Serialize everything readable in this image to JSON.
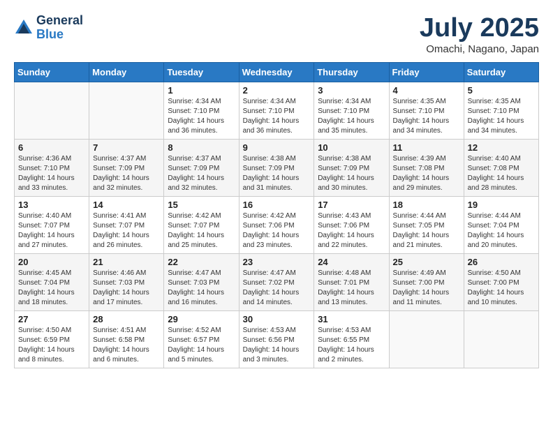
{
  "header": {
    "logo_general": "General",
    "logo_blue": "Blue",
    "month_title": "July 2025",
    "location": "Omachi, Nagano, Japan"
  },
  "days_of_week": [
    "Sunday",
    "Monday",
    "Tuesday",
    "Wednesday",
    "Thursday",
    "Friday",
    "Saturday"
  ],
  "weeks": [
    [
      {
        "day": "",
        "info": ""
      },
      {
        "day": "",
        "info": ""
      },
      {
        "day": "1",
        "info": "Sunrise: 4:34 AM\nSunset: 7:10 PM\nDaylight: 14 hours\nand 36 minutes."
      },
      {
        "day": "2",
        "info": "Sunrise: 4:34 AM\nSunset: 7:10 PM\nDaylight: 14 hours\nand 36 minutes."
      },
      {
        "day": "3",
        "info": "Sunrise: 4:34 AM\nSunset: 7:10 PM\nDaylight: 14 hours\nand 35 minutes."
      },
      {
        "day": "4",
        "info": "Sunrise: 4:35 AM\nSunset: 7:10 PM\nDaylight: 14 hours\nand 34 minutes."
      },
      {
        "day": "5",
        "info": "Sunrise: 4:35 AM\nSunset: 7:10 PM\nDaylight: 14 hours\nand 34 minutes."
      }
    ],
    [
      {
        "day": "6",
        "info": "Sunrise: 4:36 AM\nSunset: 7:10 PM\nDaylight: 14 hours\nand 33 minutes."
      },
      {
        "day": "7",
        "info": "Sunrise: 4:37 AM\nSunset: 7:09 PM\nDaylight: 14 hours\nand 32 minutes."
      },
      {
        "day": "8",
        "info": "Sunrise: 4:37 AM\nSunset: 7:09 PM\nDaylight: 14 hours\nand 32 minutes."
      },
      {
        "day": "9",
        "info": "Sunrise: 4:38 AM\nSunset: 7:09 PM\nDaylight: 14 hours\nand 31 minutes."
      },
      {
        "day": "10",
        "info": "Sunrise: 4:38 AM\nSunset: 7:09 PM\nDaylight: 14 hours\nand 30 minutes."
      },
      {
        "day": "11",
        "info": "Sunrise: 4:39 AM\nSunset: 7:08 PM\nDaylight: 14 hours\nand 29 minutes."
      },
      {
        "day": "12",
        "info": "Sunrise: 4:40 AM\nSunset: 7:08 PM\nDaylight: 14 hours\nand 28 minutes."
      }
    ],
    [
      {
        "day": "13",
        "info": "Sunrise: 4:40 AM\nSunset: 7:07 PM\nDaylight: 14 hours\nand 27 minutes."
      },
      {
        "day": "14",
        "info": "Sunrise: 4:41 AM\nSunset: 7:07 PM\nDaylight: 14 hours\nand 26 minutes."
      },
      {
        "day": "15",
        "info": "Sunrise: 4:42 AM\nSunset: 7:07 PM\nDaylight: 14 hours\nand 25 minutes."
      },
      {
        "day": "16",
        "info": "Sunrise: 4:42 AM\nSunset: 7:06 PM\nDaylight: 14 hours\nand 23 minutes."
      },
      {
        "day": "17",
        "info": "Sunrise: 4:43 AM\nSunset: 7:06 PM\nDaylight: 14 hours\nand 22 minutes."
      },
      {
        "day": "18",
        "info": "Sunrise: 4:44 AM\nSunset: 7:05 PM\nDaylight: 14 hours\nand 21 minutes."
      },
      {
        "day": "19",
        "info": "Sunrise: 4:44 AM\nSunset: 7:04 PM\nDaylight: 14 hours\nand 20 minutes."
      }
    ],
    [
      {
        "day": "20",
        "info": "Sunrise: 4:45 AM\nSunset: 7:04 PM\nDaylight: 14 hours\nand 18 minutes."
      },
      {
        "day": "21",
        "info": "Sunrise: 4:46 AM\nSunset: 7:03 PM\nDaylight: 14 hours\nand 17 minutes."
      },
      {
        "day": "22",
        "info": "Sunrise: 4:47 AM\nSunset: 7:03 PM\nDaylight: 14 hours\nand 16 minutes."
      },
      {
        "day": "23",
        "info": "Sunrise: 4:47 AM\nSunset: 7:02 PM\nDaylight: 14 hours\nand 14 minutes."
      },
      {
        "day": "24",
        "info": "Sunrise: 4:48 AM\nSunset: 7:01 PM\nDaylight: 14 hours\nand 13 minutes."
      },
      {
        "day": "25",
        "info": "Sunrise: 4:49 AM\nSunset: 7:00 PM\nDaylight: 14 hours\nand 11 minutes."
      },
      {
        "day": "26",
        "info": "Sunrise: 4:50 AM\nSunset: 7:00 PM\nDaylight: 14 hours\nand 10 minutes."
      }
    ],
    [
      {
        "day": "27",
        "info": "Sunrise: 4:50 AM\nSunset: 6:59 PM\nDaylight: 14 hours\nand 8 minutes."
      },
      {
        "day": "28",
        "info": "Sunrise: 4:51 AM\nSunset: 6:58 PM\nDaylight: 14 hours\nand 6 minutes."
      },
      {
        "day": "29",
        "info": "Sunrise: 4:52 AM\nSunset: 6:57 PM\nDaylight: 14 hours\nand 5 minutes."
      },
      {
        "day": "30",
        "info": "Sunrise: 4:53 AM\nSunset: 6:56 PM\nDaylight: 14 hours\nand 3 minutes."
      },
      {
        "day": "31",
        "info": "Sunrise: 4:53 AM\nSunset: 6:55 PM\nDaylight: 14 hours\nand 2 minutes."
      },
      {
        "day": "",
        "info": ""
      },
      {
        "day": "",
        "info": ""
      }
    ]
  ]
}
